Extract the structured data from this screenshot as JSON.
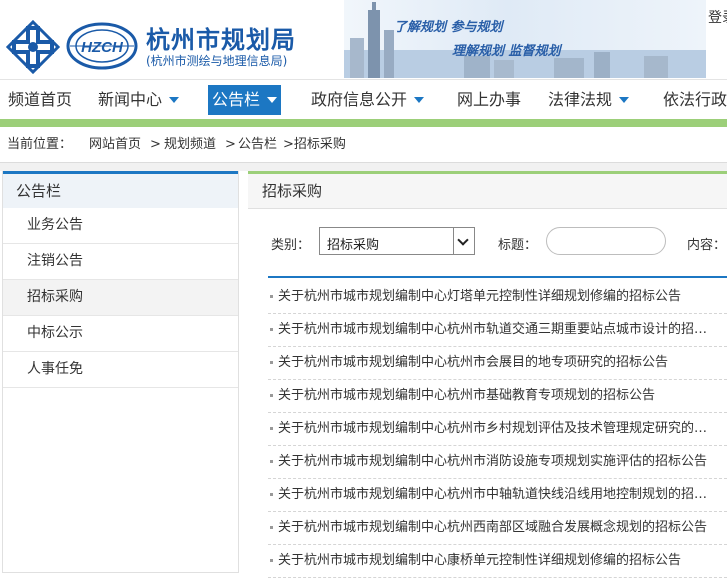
{
  "header": {
    "title": "杭州市规划局",
    "subtitle": "(杭州市测绘与地理信息局)",
    "logo_text": "HZCH",
    "slogan_line1": "了解规划 参与规划",
    "slogan_line2": "理解规划 监督规划",
    "login_label": "登录"
  },
  "nav": {
    "items": [
      {
        "label": "频道首页"
      },
      {
        "label": "新闻中心"
      },
      {
        "label": "公告栏"
      },
      {
        "label": "政府信息公开"
      },
      {
        "label": "网上办事"
      },
      {
        "label": "法律法规"
      },
      {
        "label": "依法行政"
      }
    ],
    "active_color": "#1c77c3"
  },
  "breadcrumb": {
    "prefix": "当前位置：",
    "home": "网站首页",
    "sep1": ">",
    "channel": "规划频道",
    "sep2": ">",
    "section": "公告栏",
    "current": ">招标采购"
  },
  "sidebar": {
    "heading": "公告栏",
    "items": [
      {
        "label": "业务公告"
      },
      {
        "label": "注销公告"
      },
      {
        "label": "招标采购"
      },
      {
        "label": "中标公示"
      },
      {
        "label": "人事任免"
      }
    ]
  },
  "main": {
    "heading": "招标采购",
    "filter": {
      "category_label": "类别：",
      "category_value": "招标采购",
      "title_label": "标题：",
      "title_value": "",
      "content_label": "内容："
    },
    "list": [
      "关于杭州市城市规划编制中心灯塔单元控制性详细规划修编的招标公告",
      "关于杭州市城市规划编制中心杭州市轨道交通三期重要站点城市设计的招标公告",
      "关于杭州市城市规划编制中心杭州市会展目的地专项研究的招标公告",
      "关于杭州市城市规划编制中心杭州市基础教育专项规划的招标公告",
      "关于杭州市城市规划编制中心杭州市乡村规划评估及技术管理规定研究的招标公告",
      "关于杭州市城市规划编制中心杭州市消防设施专项规划实施评估的招标公告",
      "关于杭州市城市规划编制中心杭州市中轴轨道快线沿线用地控制规划的招标公告",
      "关于杭州市城市规划编制中心杭州西南部区域融合发展概念规划的招标公告",
      "关于杭州市城市规划编制中心康桥单元控制性详细规划修编的招标公告"
    ]
  },
  "colors": {
    "brand_blue": "#1a5aa8",
    "accent_green": "#9ccf79"
  }
}
